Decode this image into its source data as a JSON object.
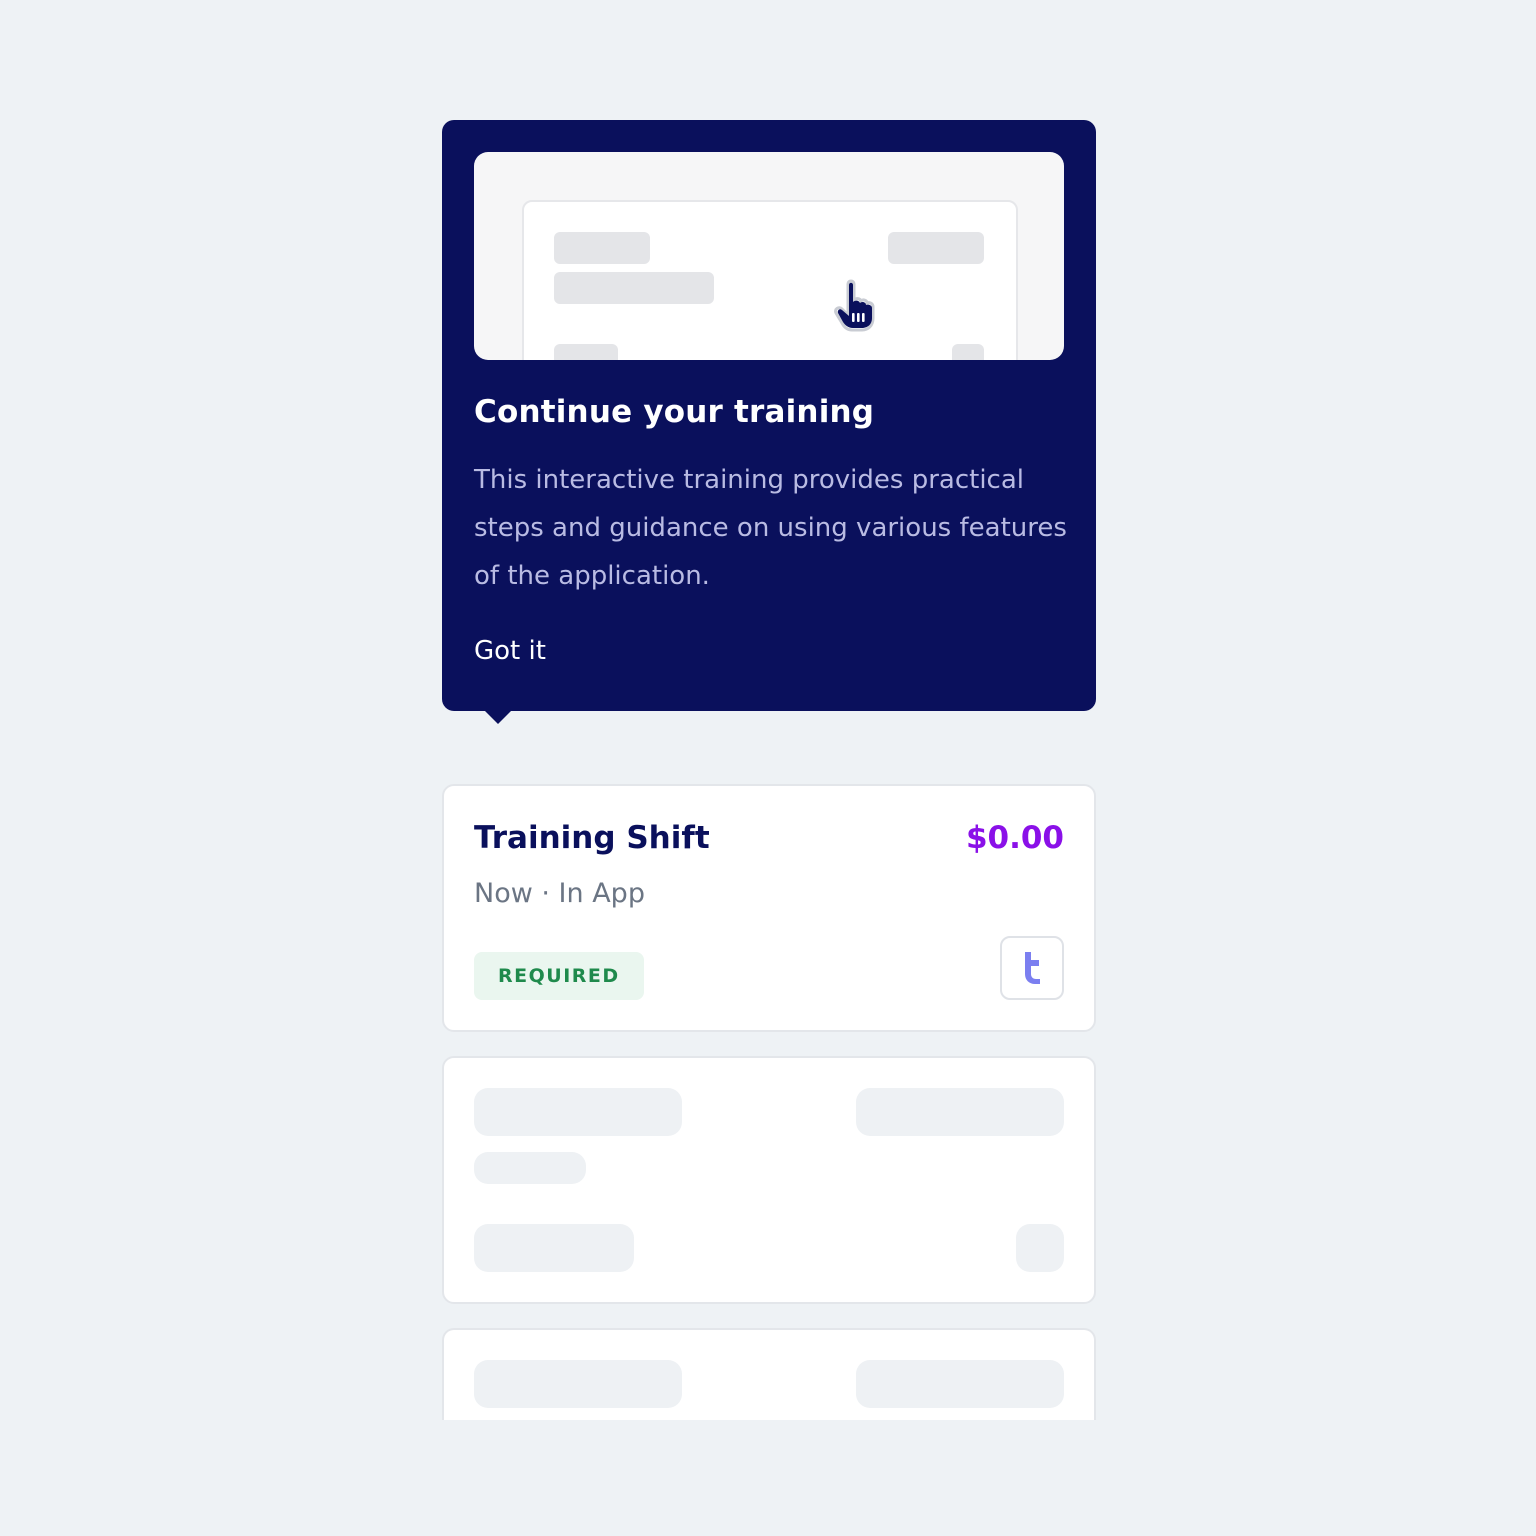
{
  "tooltip": {
    "title": "Continue your training",
    "body": "This interactive training provides practical steps and guidance on using various features of the application.",
    "dismiss_label": "Got it",
    "icon": "pointer-hand-icon"
  },
  "shift_card": {
    "title": "Training Shift",
    "price": "$0.00",
    "meta": "Now · In App",
    "badge": "REQUIRED",
    "app_icon": "t-logo-icon"
  },
  "colors": {
    "background": "#eef2f5",
    "tooltip_bg": "#0a105c",
    "price": "#8a10e8",
    "badge_text": "#1f8a4c",
    "badge_bg": "#eaf6ef",
    "logo": "#7b7ff0"
  }
}
